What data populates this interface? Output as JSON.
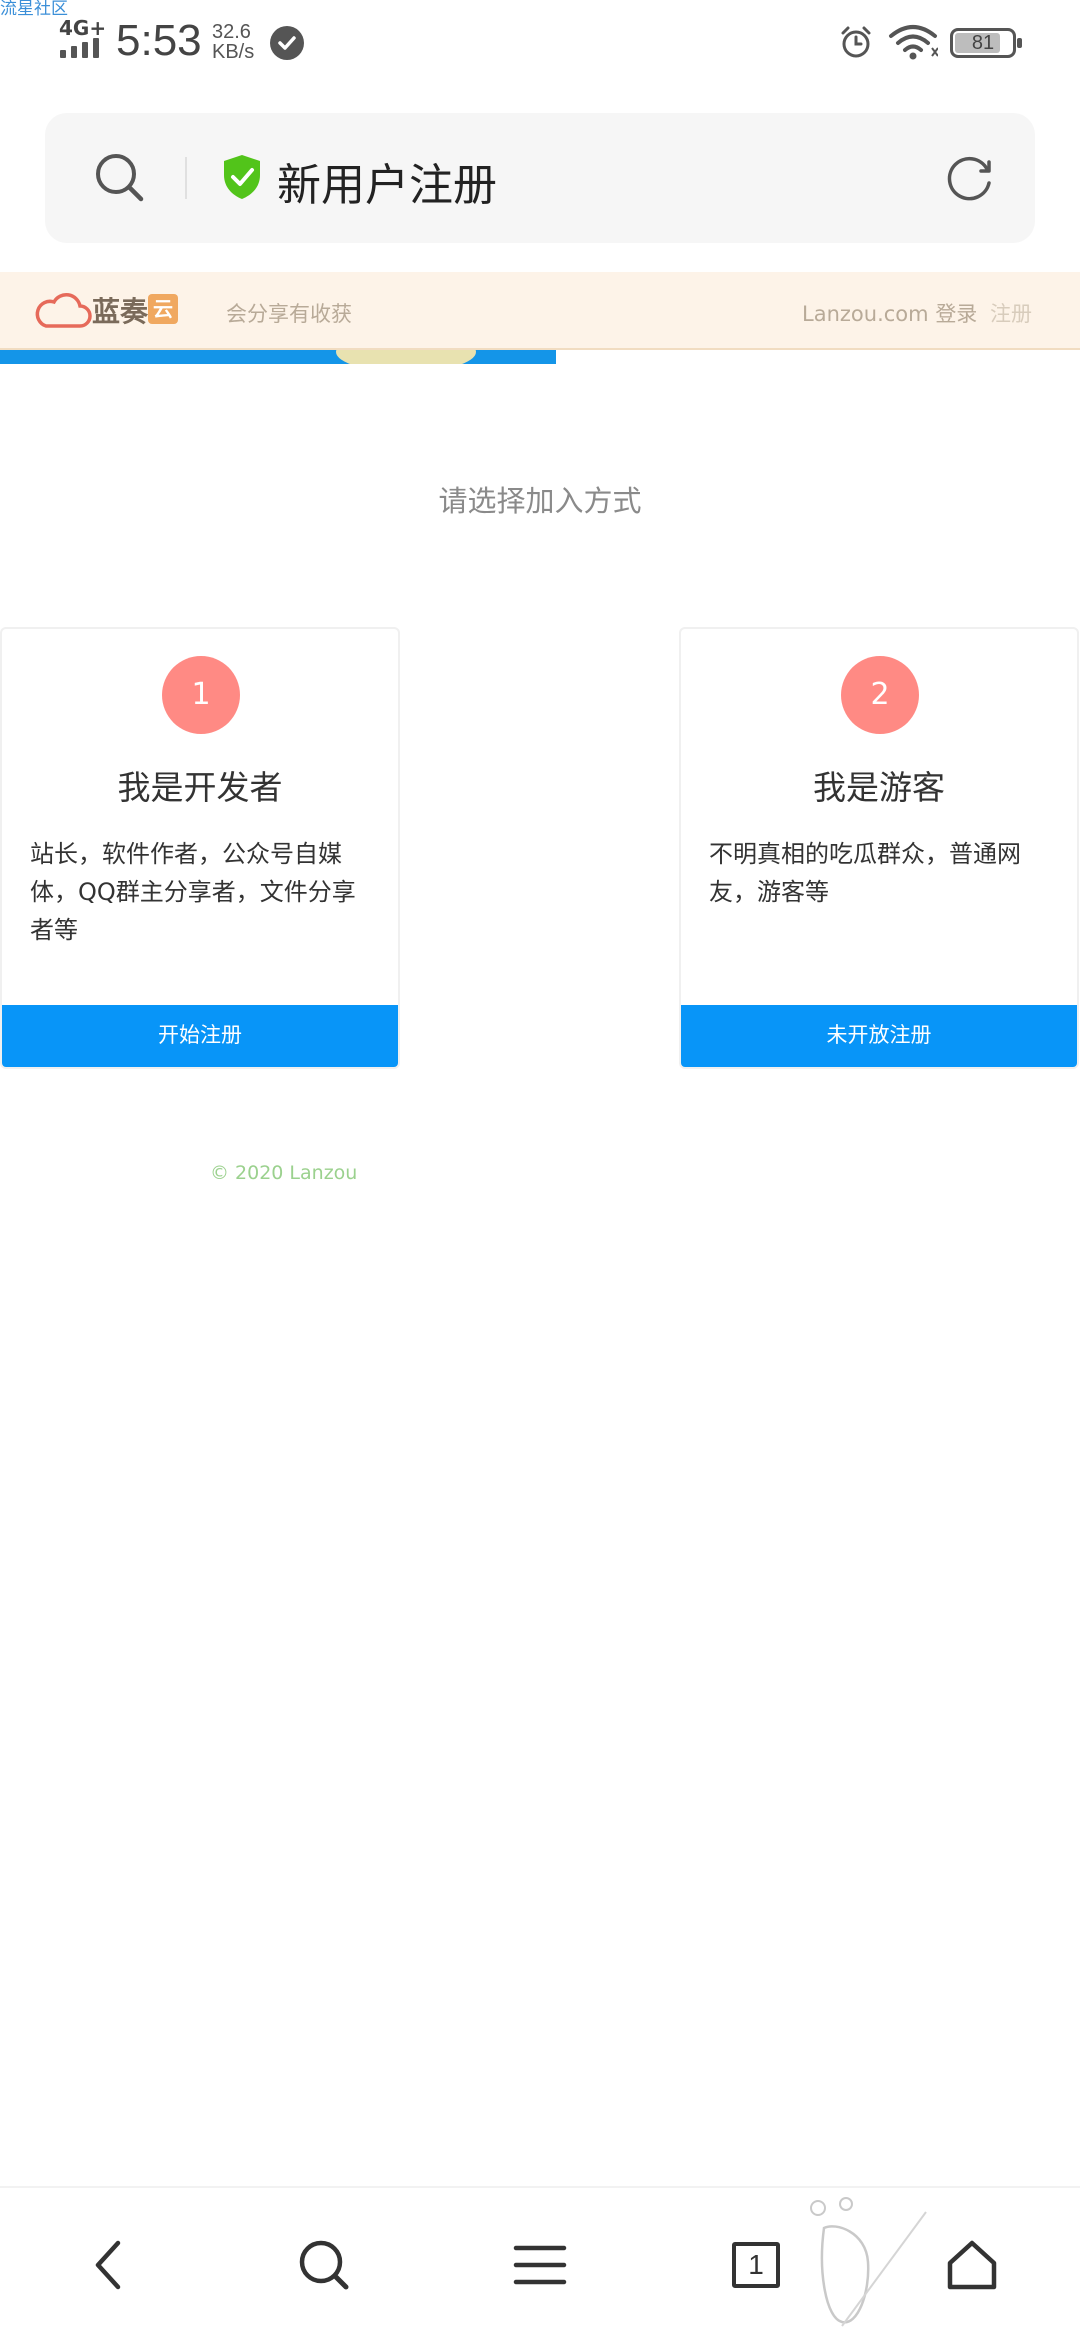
{
  "watermark": "流星社区",
  "status_bar": {
    "network": "4G+",
    "time": "5:53",
    "speed_value": "32.6",
    "speed_unit": "KB/s",
    "battery": "81",
    "battery_level": 0.81
  },
  "address_bar": {
    "title": "新用户注册"
  },
  "site_header": {
    "logo_text": "蓝奏",
    "logo_badge": "云",
    "slogan": "会分享有收获",
    "domain": "Lanzou.com",
    "login": "登录",
    "register": "注册"
  },
  "main": {
    "choose_title": "请选择加入方式",
    "cards": [
      {
        "number": "1",
        "title": "我是开发者",
        "desc": "站长，软件作者，公众号自媒体，QQ群主分享者，文件分享者等",
        "button": "开始注册"
      },
      {
        "number": "2",
        "title": "我是游客",
        "desc": "不明真相的吃瓜群众，普通网友，游客等",
        "button": "未开放注册"
      }
    ],
    "footer": "© 2020 Lanzou"
  },
  "bottom_nav": {
    "tab_count": "1"
  },
  "colors": {
    "accent_blue": "#0895f8",
    "badge_red": "#ff8a84",
    "shield_green": "#52c41a",
    "header_bg": "#fdf3e8"
  }
}
